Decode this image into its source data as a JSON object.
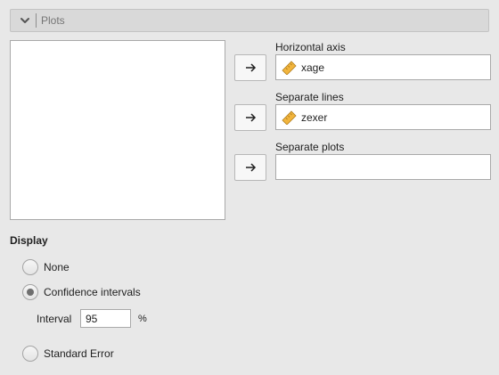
{
  "section": {
    "title": "Plots",
    "collapse_icon": "chevron-down-icon"
  },
  "transfer_icon": "arrow-right-icon",
  "variable_icon": "ruler-scale-icon",
  "targets": {
    "horizontal_axis": {
      "label": "Horizontal axis",
      "value": "xage"
    },
    "separate_lines": {
      "label": "Separate lines",
      "value": "zexer"
    },
    "separate_plots": {
      "label": "Separate plots",
      "value": ""
    }
  },
  "display": {
    "heading": "Display",
    "options": {
      "none": {
        "label": "None",
        "selected": false
      },
      "ci": {
        "label": "Confidence intervals",
        "selected": true
      },
      "se": {
        "label": "Standard Error",
        "selected": false
      }
    },
    "interval": {
      "label": "Interval",
      "value": "95",
      "suffix": "%"
    }
  },
  "colors": {
    "background": "#e8e8e8",
    "header_background": "#d9d9d9",
    "variable_icon": "#f2b53d"
  }
}
